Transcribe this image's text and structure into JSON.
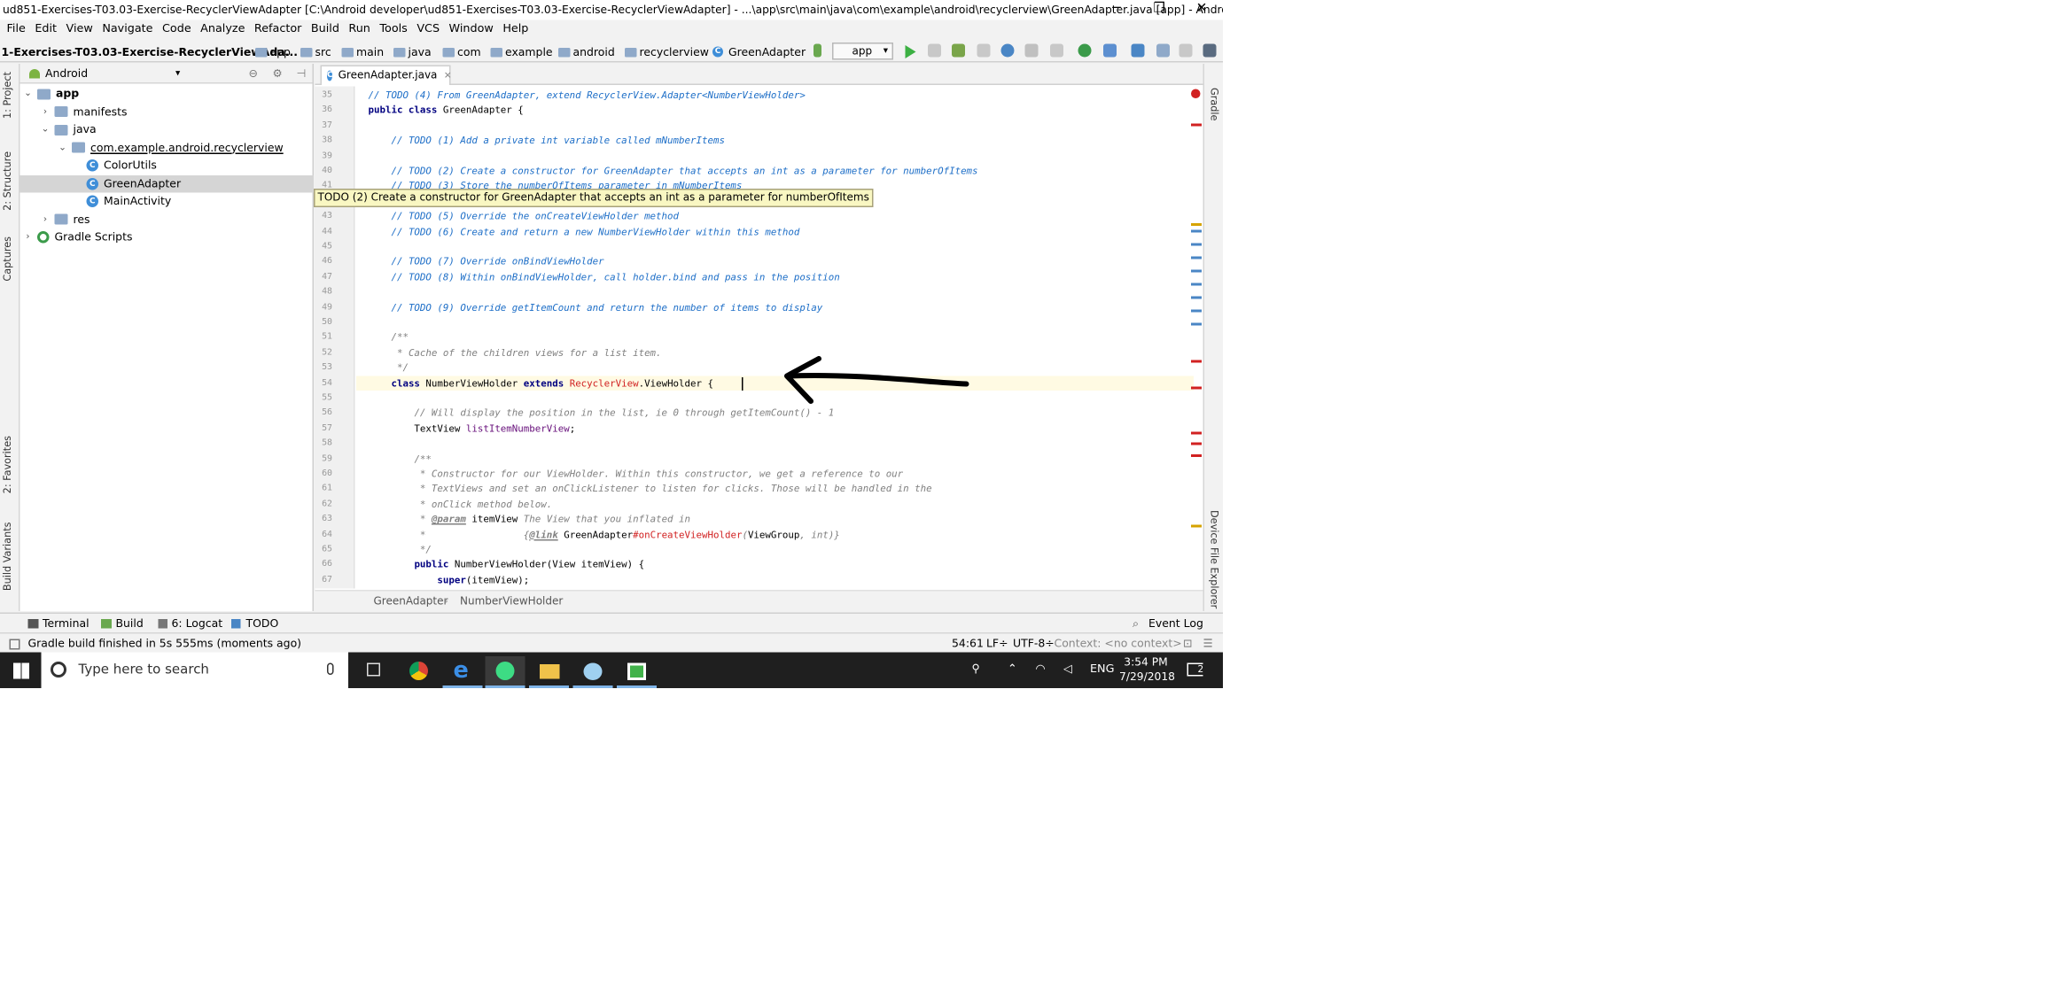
{
  "window": {
    "title": "ud851-Exercises-T03.03-Exercise-RecyclerViewAdapter [C:\\Android developer\\ud851-Exercises-T03.03-Exercise-RecyclerViewAdapter] - ...\\app\\src\\main\\java\\com\\example\\android\\recyclerview\\GreenAdapter.java [app] - Andro...",
    "minimize": "─",
    "restore": "❐",
    "close": "✕"
  },
  "menu": [
    "File",
    "Edit",
    "View",
    "Navigate",
    "Code",
    "Analyze",
    "Refactor",
    "Build",
    "Run",
    "Tools",
    "VCS",
    "Window",
    "Help"
  ],
  "navbar": {
    "project": "1-Exercises-T03.03-Exercise-RecyclerViewAda...",
    "crumbs": [
      "app",
      "src",
      "main",
      "java",
      "com",
      "example",
      "android",
      "recyclerview",
      "GreenAdapter"
    ],
    "run_config": "app"
  },
  "left_strip": [
    "1: Project",
    "2: Structure",
    "Captures",
    "2: Favorites",
    "Build Variants"
  ],
  "right_strip": [
    "Gradle",
    "Device File Explorer"
  ],
  "project_panel": {
    "view": "Android",
    "tree": [
      {
        "label": "app",
        "level": 0,
        "type": "folder",
        "open": true
      },
      {
        "label": "manifests",
        "level": 1,
        "type": "folder",
        "open": false
      },
      {
        "label": "java",
        "level": 1,
        "type": "folder",
        "open": true
      },
      {
        "label": "com.example.android.recyclerview",
        "level": 2,
        "type": "folder",
        "open": true
      },
      {
        "label": "ColorUtils",
        "level": 3,
        "type": "class"
      },
      {
        "label": "GreenAdapter",
        "level": 3,
        "type": "class",
        "selected": true
      },
      {
        "label": "MainActivity",
        "level": 3,
        "type": "class"
      },
      {
        "label": "res",
        "level": 1,
        "type": "folder",
        "open": false
      },
      {
        "label": "Gradle Scripts",
        "level": 0,
        "type": "gradle",
        "open": false
      }
    ]
  },
  "editor": {
    "tab": "GreenAdapter.java",
    "lines": [
      {
        "n": "35",
        "html": "<span class=\"cm\">// TODO (4) From GreenAdapter, extend RecyclerView.Adapter&lt;NumberViewHolder&gt;</span>"
      },
      {
        "n": "36",
        "html": "<span class=\"kw\">public class</span> GreenAdapter {"
      },
      {
        "n": "37",
        "html": ""
      },
      {
        "n": "38",
        "html": "    <span class=\"cm\">// TODO (1) Add a private int variable called mNumberItems</span>"
      },
      {
        "n": "39",
        "html": ""
      },
      {
        "n": "40",
        "html": "    <span class=\"cm\">// TODO (2) Create a constructor for GreenAdapter that accepts an int as a parameter for numberOfItems</span>"
      },
      {
        "n": "41",
        "html": "    <span class=\"cm\">// TODO (3) Store the numberOfItems parameter in mNumberItems</span>"
      },
      {
        "n": "42",
        "html": ""
      },
      {
        "n": "43",
        "html": "    <span class=\"cm\">// TODO (5) Override the onCreateViewHolder method</span>"
      },
      {
        "n": "44",
        "html": "    <span class=\"cm\">// TODO (6) Create and return a new NumberViewHolder within this method</span>"
      },
      {
        "n": "45",
        "html": ""
      },
      {
        "n": "46",
        "html": "    <span class=\"cm\">// TODO (7) Override onBindViewHolder</span>"
      },
      {
        "n": "47",
        "html": "    <span class=\"cm\">// TODO (8) Within onBindViewHolder, call holder.bind and pass in the position</span>"
      },
      {
        "n": "48",
        "html": ""
      },
      {
        "n": "49",
        "html": "    <span class=\"cm\">// TODO (9) Override getItemCount and return the number of items to display</span>"
      },
      {
        "n": "50",
        "html": ""
      },
      {
        "n": "51",
        "html": "    <span class=\"cg\">/**</span>"
      },
      {
        "n": "52",
        "html": "    <span class=\"cg\"> * Cache of the children views for a list item.</span>"
      },
      {
        "n": "53",
        "html": "    <span class=\"cg\"> */</span>"
      },
      {
        "n": "54",
        "html": "    <span class=\"kw\">class</span> NumberViewHolder <span class=\"kw\">extends</span> <span class=\"red\">RecyclerView</span>.ViewHolder {"
      },
      {
        "n": "55",
        "html": ""
      },
      {
        "n": "56",
        "html": "        <span class=\"cg\">// Will display the position in the list, ie 0 through getItemCount() - 1</span>"
      },
      {
        "n": "57",
        "html": "        TextView <span style=\"color:#660e7a\">listItemNumberView</span>;"
      },
      {
        "n": "58",
        "html": ""
      },
      {
        "n": "59",
        "html": "        <span class=\"cg\">/**</span>"
      },
      {
        "n": "60",
        "html": "        <span class=\"cg\"> * Constructor for our ViewHolder. Within this constructor, we get a reference to our</span>"
      },
      {
        "n": "61",
        "html": "        <span class=\"cg\"> * TextViews and set an onClickListener to listen for clicks. Those will be handled in the</span>"
      },
      {
        "n": "62",
        "html": "        <span class=\"cg\"> * onClick method below.</span>"
      },
      {
        "n": "63",
        "html": "        <span class=\"cg\"> * <b><u>@param</u></b> </span>itemView <span class=\"cg\">The View that you inflated in</span>"
      },
      {
        "n": "64",
        "html": "        <span class=\"cg\"> *                 {<b><u>@link</u></b> </span>GreenAdapter<span class=\"red\">#onCreateViewHolder</span><span class=\"cg\">(</span>ViewGroup<span class=\"cg\">, int)}</span>"
      },
      {
        "n": "65",
        "html": "        <span class=\"cg\"> */</span>"
      },
      {
        "n": "66",
        "html": "        <span class=\"kw\">public</span> NumberViewHolder(View itemView) {"
      },
      {
        "n": "67",
        "html": "            <span class=\"kw\">super</span>(itemView);"
      }
    ],
    "tooltip": "TODO (2) Create a constructor for GreenAdapter that accepts an int as a parameter for numberOfItems",
    "breadcrumbs": [
      "GreenAdapter",
      "NumberViewHolder"
    ]
  },
  "tool_windows": {
    "terminal": "Terminal",
    "build": "Build",
    "logcat": "6: Logcat",
    "todo": "TODO",
    "event_log": "Event Log"
  },
  "status": {
    "message": "Gradle build finished in 5s 555ms (moments ago)",
    "position": "54:61",
    "line_sep": "LF÷",
    "encoding": "UTF-8÷",
    "context": "Context: <no context>"
  },
  "taskbar": {
    "search_placeholder": "Type here to search",
    "lang": "ENG",
    "time": "3:54 PM",
    "date": "7/29/2018",
    "notif_count": "2"
  },
  "colors": {
    "accent_selection": "#d5d5d5",
    "comment_blue": "#1d6ec7",
    "error_red": "#d12121",
    "taskbar": "#1f1f1f"
  }
}
